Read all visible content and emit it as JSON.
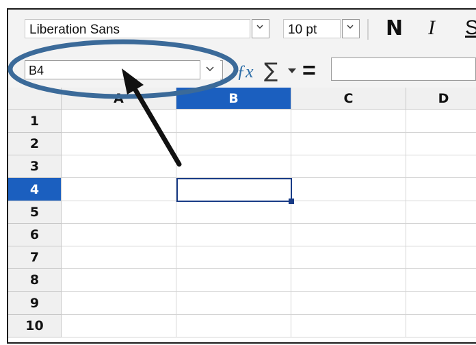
{
  "toolbar": {
    "font_name": "Liberation Sans",
    "font_size": "10 pt",
    "bold_label": "N",
    "italic_label": "I",
    "underline_label": "S"
  },
  "formula_bar": {
    "name_box": "B4",
    "function_wizard_icon": "fx-icon",
    "sum_icon": "sigma-icon",
    "formula_icon": "equals-icon",
    "formula_value": ""
  },
  "grid": {
    "columns": [
      "A",
      "B",
      "C",
      "D"
    ],
    "rows": [
      "1",
      "2",
      "3",
      "4",
      "5",
      "6",
      "7",
      "8",
      "9",
      "10"
    ],
    "selected_column": "B",
    "selected_row": "4",
    "active_cell": "B4"
  },
  "colors": {
    "selection": "#1b5fbf",
    "active_cell_border": "#183b86",
    "annotation": "#3b6a99",
    "arrow": "#111111"
  }
}
